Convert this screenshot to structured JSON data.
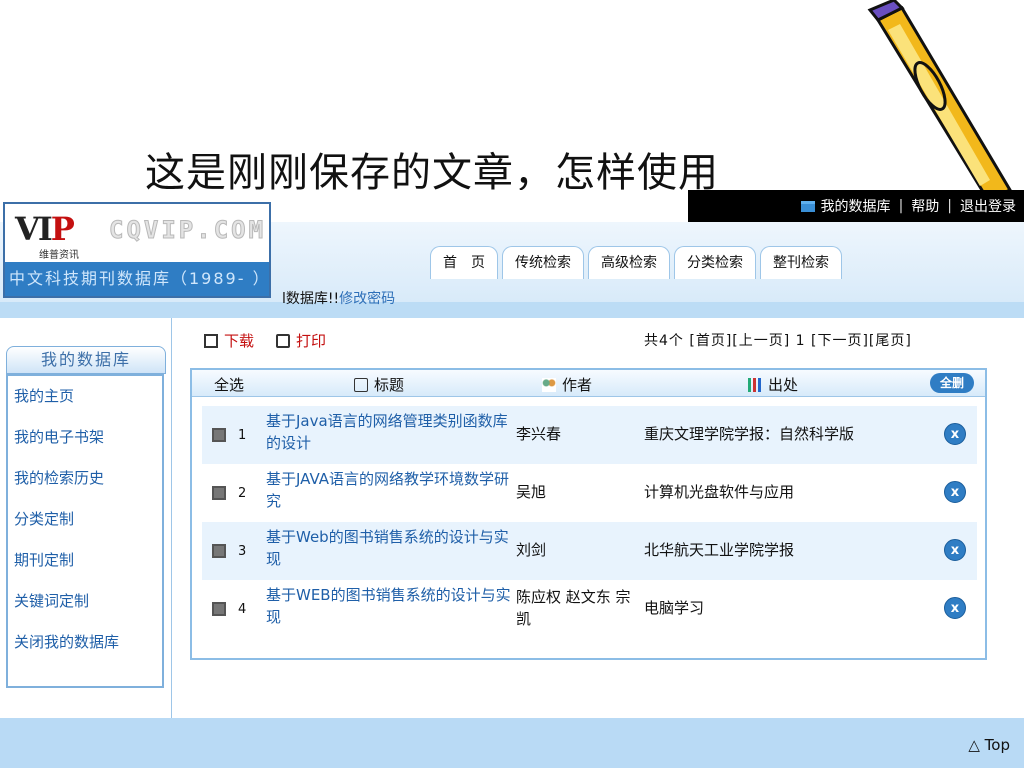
{
  "slide": {
    "title": "这是刚刚保存的文章，怎样使用"
  },
  "topbar": {
    "my_db": "我的数据库",
    "help": "帮助",
    "logout": "退出登录",
    "sep": "|"
  },
  "logo": {
    "vip_v": "VI",
    "vip_p": "P",
    "sub": "维普资讯",
    "brand": "CQVIP.COM",
    "strip": "中文科技期刊数据库（1989- ）"
  },
  "tabs": [
    "首　页",
    "传统检索",
    "高级检索",
    "分类检索",
    "整刊检索"
  ],
  "welcome": {
    "text": "l数据库!!",
    "change_pw": "修改密码"
  },
  "sidebar": {
    "header": "我的数据库",
    "items": [
      "我的主页",
      "我的电子书架",
      "我的检索历史",
      "分类定制",
      "期刊定制",
      "关键词定制",
      "关闭我的数据库"
    ]
  },
  "toolbar": {
    "download": "下载",
    "print": "打印"
  },
  "pager": {
    "text": "共4个 [首页][上一页] 1 [下一页][尾页]"
  },
  "table": {
    "headers": {
      "select_all": "全选",
      "title": "标题",
      "author": "作者",
      "source": "出处",
      "delete_all": "全删"
    },
    "rows": [
      {
        "num": "1",
        "title": "基于Java语言的网络管理类别函数库的设计",
        "author": "李兴春",
        "source": "重庆文理学院学报：自然科学版"
      },
      {
        "num": "2",
        "title": "基于JAVA语言的网络教学环境数学研究",
        "author": "吴旭",
        "source": "计算机光盘软件与应用"
      },
      {
        "num": "3",
        "title": "基于Web的图书销售系统的设计与实现",
        "author": "刘剑",
        "source": "北华航天工业学院学报"
      },
      {
        "num": "4",
        "title": "基于WEB的图书销售系统的设计与实现",
        "author": "陈应权 赵文东 宗凯",
        "source": "电脑学习"
      }
    ],
    "delete_glyph": "x"
  },
  "footer": {
    "top": "△ Top"
  },
  "colors": {
    "accent": "#2f7dc4",
    "link": "#1f5fa8",
    "band": "#b9daf5",
    "red": "#c41010"
  }
}
